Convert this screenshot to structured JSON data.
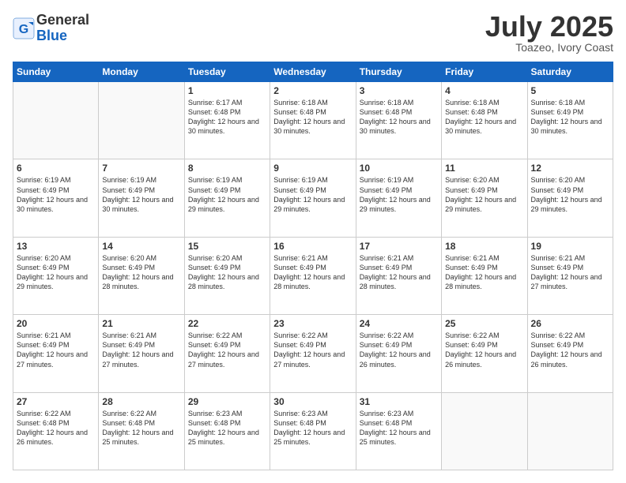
{
  "header": {
    "logo_line1": "General",
    "logo_line2": "Blue",
    "month_title": "July 2025",
    "subtitle": "Toazeo, Ivory Coast"
  },
  "weekdays": [
    "Sunday",
    "Monday",
    "Tuesday",
    "Wednesday",
    "Thursday",
    "Friday",
    "Saturday"
  ],
  "weeks": [
    [
      {
        "day": "",
        "info": ""
      },
      {
        "day": "",
        "info": ""
      },
      {
        "day": "1",
        "info": "Sunrise: 6:17 AM\nSunset: 6:48 PM\nDaylight: 12 hours and 30 minutes."
      },
      {
        "day": "2",
        "info": "Sunrise: 6:18 AM\nSunset: 6:48 PM\nDaylight: 12 hours and 30 minutes."
      },
      {
        "day": "3",
        "info": "Sunrise: 6:18 AM\nSunset: 6:48 PM\nDaylight: 12 hours and 30 minutes."
      },
      {
        "day": "4",
        "info": "Sunrise: 6:18 AM\nSunset: 6:48 PM\nDaylight: 12 hours and 30 minutes."
      },
      {
        "day": "5",
        "info": "Sunrise: 6:18 AM\nSunset: 6:49 PM\nDaylight: 12 hours and 30 minutes."
      }
    ],
    [
      {
        "day": "6",
        "info": "Sunrise: 6:19 AM\nSunset: 6:49 PM\nDaylight: 12 hours and 30 minutes."
      },
      {
        "day": "7",
        "info": "Sunrise: 6:19 AM\nSunset: 6:49 PM\nDaylight: 12 hours and 30 minutes."
      },
      {
        "day": "8",
        "info": "Sunrise: 6:19 AM\nSunset: 6:49 PM\nDaylight: 12 hours and 29 minutes."
      },
      {
        "day": "9",
        "info": "Sunrise: 6:19 AM\nSunset: 6:49 PM\nDaylight: 12 hours and 29 minutes."
      },
      {
        "day": "10",
        "info": "Sunrise: 6:19 AM\nSunset: 6:49 PM\nDaylight: 12 hours and 29 minutes."
      },
      {
        "day": "11",
        "info": "Sunrise: 6:20 AM\nSunset: 6:49 PM\nDaylight: 12 hours and 29 minutes."
      },
      {
        "day": "12",
        "info": "Sunrise: 6:20 AM\nSunset: 6:49 PM\nDaylight: 12 hours and 29 minutes."
      }
    ],
    [
      {
        "day": "13",
        "info": "Sunrise: 6:20 AM\nSunset: 6:49 PM\nDaylight: 12 hours and 29 minutes."
      },
      {
        "day": "14",
        "info": "Sunrise: 6:20 AM\nSunset: 6:49 PM\nDaylight: 12 hours and 28 minutes."
      },
      {
        "day": "15",
        "info": "Sunrise: 6:20 AM\nSunset: 6:49 PM\nDaylight: 12 hours and 28 minutes."
      },
      {
        "day": "16",
        "info": "Sunrise: 6:21 AM\nSunset: 6:49 PM\nDaylight: 12 hours and 28 minutes."
      },
      {
        "day": "17",
        "info": "Sunrise: 6:21 AM\nSunset: 6:49 PM\nDaylight: 12 hours and 28 minutes."
      },
      {
        "day": "18",
        "info": "Sunrise: 6:21 AM\nSunset: 6:49 PM\nDaylight: 12 hours and 28 minutes."
      },
      {
        "day": "19",
        "info": "Sunrise: 6:21 AM\nSunset: 6:49 PM\nDaylight: 12 hours and 27 minutes."
      }
    ],
    [
      {
        "day": "20",
        "info": "Sunrise: 6:21 AM\nSunset: 6:49 PM\nDaylight: 12 hours and 27 minutes."
      },
      {
        "day": "21",
        "info": "Sunrise: 6:21 AM\nSunset: 6:49 PM\nDaylight: 12 hours and 27 minutes."
      },
      {
        "day": "22",
        "info": "Sunrise: 6:22 AM\nSunset: 6:49 PM\nDaylight: 12 hours and 27 minutes."
      },
      {
        "day": "23",
        "info": "Sunrise: 6:22 AM\nSunset: 6:49 PM\nDaylight: 12 hours and 27 minutes."
      },
      {
        "day": "24",
        "info": "Sunrise: 6:22 AM\nSunset: 6:49 PM\nDaylight: 12 hours and 26 minutes."
      },
      {
        "day": "25",
        "info": "Sunrise: 6:22 AM\nSunset: 6:49 PM\nDaylight: 12 hours and 26 minutes."
      },
      {
        "day": "26",
        "info": "Sunrise: 6:22 AM\nSunset: 6:49 PM\nDaylight: 12 hours and 26 minutes."
      }
    ],
    [
      {
        "day": "27",
        "info": "Sunrise: 6:22 AM\nSunset: 6:48 PM\nDaylight: 12 hours and 26 minutes."
      },
      {
        "day": "28",
        "info": "Sunrise: 6:22 AM\nSunset: 6:48 PM\nDaylight: 12 hours and 25 minutes."
      },
      {
        "day": "29",
        "info": "Sunrise: 6:23 AM\nSunset: 6:48 PM\nDaylight: 12 hours and 25 minutes."
      },
      {
        "day": "30",
        "info": "Sunrise: 6:23 AM\nSunset: 6:48 PM\nDaylight: 12 hours and 25 minutes."
      },
      {
        "day": "31",
        "info": "Sunrise: 6:23 AM\nSunset: 6:48 PM\nDaylight: 12 hours and 25 minutes."
      },
      {
        "day": "",
        "info": ""
      },
      {
        "day": "",
        "info": ""
      }
    ]
  ]
}
